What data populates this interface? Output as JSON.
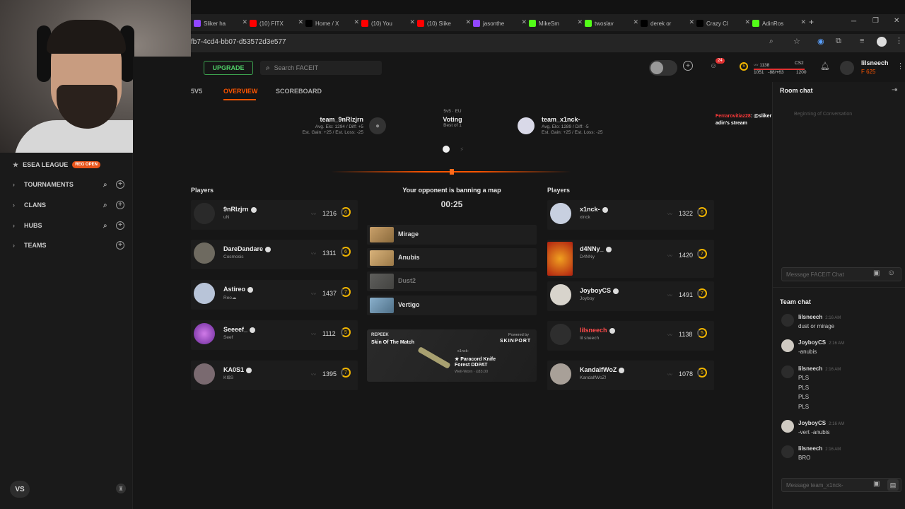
{
  "browser": {
    "tabs": [
      {
        "label": "Sliker ha",
        "icon": "twitch-icon",
        "color": "#9146ff"
      },
      {
        "label": "(10) FITX",
        "icon": "youtube-icon",
        "color": "#ff0000"
      },
      {
        "label": "Home / X",
        "icon": "x-icon",
        "color": "#000000"
      },
      {
        "label": "(10) You",
        "icon": "youtube-icon",
        "color": "#ff0000"
      },
      {
        "label": "(10) Slike",
        "icon": "youtube-icon",
        "color": "#ff0000"
      },
      {
        "label": "jasonthe",
        "icon": "twitch-icon",
        "color": "#9146ff"
      },
      {
        "label": "MikeSm",
        "icon": "kick-icon",
        "color": "#53fc18"
      },
      {
        "label": "twoslav",
        "icon": "kick-icon",
        "color": "#53fc18"
      },
      {
        "label": "derek or",
        "icon": "x-icon",
        "color": "#000000"
      },
      {
        "label": "Crazy Cl",
        "icon": "x-icon",
        "color": "#000000"
      },
      {
        "label": "AdinRos",
        "icon": "kick-icon",
        "color": "#53fc18"
      }
    ],
    "url": "fb7-4cd4-bb07-d53572d3e577"
  },
  "header": {
    "upgrade": "UPGRADE",
    "search_placeholder": "Search FACEIT",
    "notif_count": "24",
    "elo_level": "5",
    "elo_value": "1138",
    "elo_game": "CS2",
    "elo_range": "1051",
    "elo_diff": "-88/+63",
    "elo_next": "1200",
    "username": "lilsneech",
    "points": "625"
  },
  "sidebar": {
    "league": "ESEA LEAGUE",
    "league_badge": "REG OPEN",
    "items": [
      "TOURNAMENTS",
      "CLANS",
      "HUBS",
      "TEAMS"
    ],
    "vs": "VS"
  },
  "match": {
    "nav": [
      "5V5",
      "OVERVIEW",
      "SCOREBOARD"
    ],
    "team1": {
      "name": "team_9nRlzjrn",
      "elo": "Avg. Elo: 1294 / Diff: +5",
      "gain": "Est. Gain: +25 / Est. Loss: -25"
    },
    "team2": {
      "name": "team_x1nck-",
      "elo": "Avg. Elo: 1289 / Diff: -5",
      "gain": "Est. Gain: +25 / Est. Loss: -25"
    },
    "mode": "5v5 · EU",
    "status": "Voting",
    "best_of": "Best of 1",
    "players_label": "Players",
    "ban_status": "Your opponent is banning a map",
    "timer": "00:25",
    "maps": [
      {
        "name": "Mirage",
        "banned": false
      },
      {
        "name": "Anubis",
        "banned": false
      },
      {
        "name": "Dust2",
        "banned": true
      },
      {
        "name": "Vertigo",
        "banned": false
      }
    ],
    "left_players": [
      {
        "name": "9nRlzjrn",
        "sub": "uN",
        "elo": "1216",
        "lvl": "6"
      },
      {
        "name": "DareDandare",
        "sub": "Cosmosis",
        "elo": "1311",
        "lvl": "6"
      },
      {
        "name": "Astireo",
        "sub": "Reo☁",
        "elo": "1437",
        "lvl": "7"
      },
      {
        "name": "Seeeef_",
        "sub": "Seef",
        "elo": "1112",
        "lvl": "5"
      },
      {
        "name": "KA0S1",
        "sub": "KI$S",
        "elo": "1395",
        "lvl": "7"
      }
    ],
    "right_players": [
      {
        "name": "x1nck-",
        "sub": "xinck",
        "elo": "1322",
        "lvl": "6",
        "color": "#eeeeee"
      },
      {
        "name": "d4NNy_",
        "sub": "D4NNy",
        "elo": "1420",
        "lvl": "7",
        "color": "#eeeeee"
      },
      {
        "name": "JoyboyCS",
        "sub": "Joyboy",
        "elo": "1491",
        "lvl": "7",
        "color": "#eeeeee"
      },
      {
        "name": "lilsneech",
        "sub": "lil sneech",
        "elo": "1138",
        "lvl": "5",
        "color": "#ff4a4a"
      },
      {
        "name": "KandalfWoZ",
        "sub": "KandalfWoZ!",
        "elo": "1078",
        "lvl": "5",
        "color": "#eeeeee"
      }
    ],
    "promo": {
      "brand": "REPEEK",
      "title": "Skin Of The Match",
      "powered": "Powered by",
      "sponsor": "SKINPORT",
      "owner": "x1nck-",
      "item": "★ Paracord Knife",
      "item2": "Forest DDPAT",
      "wear": "Well-Worn · £83.00"
    }
  },
  "overlay": {
    "user": "Ferrarovitiaz28",
    "text": "@sliker dont be inspired to say the n word more after youre on adin's stream"
  },
  "room_chat": {
    "title": "Room chat",
    "begin": "Beginning of Conversation",
    "placeholder": "Message FACEIT Chat"
  },
  "team_chat": {
    "title": "Team chat",
    "messages": [
      {
        "user": "lilsneech",
        "time": "2:16 AM",
        "lines": [
          "dust or mirage"
        ]
      },
      {
        "user": "JoyboyCS",
        "time": "2:16 AM",
        "lines": [
          "-anubis"
        ]
      },
      {
        "user": "lilsneech",
        "time": "2:16 AM",
        "lines": [
          "PLS",
          "PLS",
          "PLS",
          "PLS"
        ]
      },
      {
        "user": "JoyboyCS",
        "time": "2:16 AM",
        "lines": [
          "-vert -anubis"
        ]
      },
      {
        "user": "lilsneech",
        "time": "2:16 AM",
        "lines": [
          "BRO"
        ]
      }
    ],
    "placeholder": "Message team_x1nck-"
  }
}
